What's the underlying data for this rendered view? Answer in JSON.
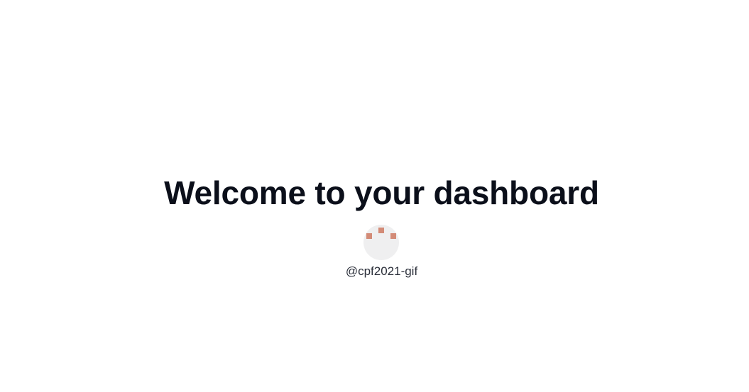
{
  "dashboard": {
    "heading": "Welcome to your dashboard",
    "user": {
      "username": "@cpf2021-gif",
      "avatar_icon": "identicon-avatar",
      "avatar_background": "#efeff0",
      "identicon_color": "#d38b77"
    }
  }
}
